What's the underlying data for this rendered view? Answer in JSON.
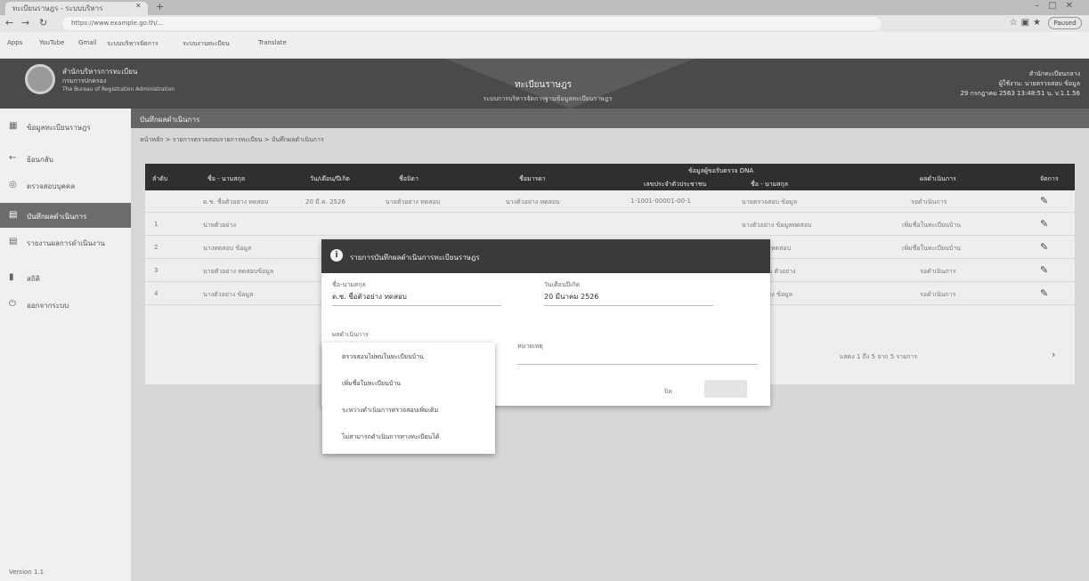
{
  "browser": {
    "tab_title": "ทะเบียนราษฎร - ระบบบริหาร",
    "address": "https://www.example.go.th/...",
    "bookmarks": [
      "Apps",
      "YouTube",
      "Gmail",
      "ระบบบริหารจัดการ",
      "ระบบงานทะเบียน",
      "Translate"
    ],
    "profile": "Paused"
  },
  "header": {
    "org_line1": "สำนักบริหารการทะเบียน",
    "org_line2": "กรมการปกครอง",
    "org_line3": "The Bureau of Registration Administration",
    "title": "ทะเบียนราษฎร",
    "subtitle": "ระบบการบริหารจัดการฐานข้อมูลทะเบียนราษฎร",
    "user_line1": "สำนักทะเบียนกลาง",
    "user_line2": "ผู้ใช้งาน: นายตรวจสอบ ข้อมูล",
    "user_line3": "29 กรกฎาคม 2563 13:48:51 น. v.1.1.56"
  },
  "sidebar": {
    "items": [
      {
        "label": "ข้อมูลทะเบียนราษฎร",
        "icon": "grid-icon"
      },
      {
        "label": "ย้อนกลับ",
        "icon": "back-icon"
      },
      {
        "label": "ตรวจสอบบุคคล",
        "icon": "user-search-icon"
      },
      {
        "label": "บันทึกผลดำเนินการ",
        "icon": "document-icon"
      },
      {
        "label": "รายงานผลการดำเนินงาน",
        "icon": "report-icon"
      },
      {
        "label": "สถิติ",
        "icon": "chart-icon"
      },
      {
        "label": "ออกจากระบบ",
        "icon": "logout-icon"
      }
    ],
    "footer": "Version 1.1"
  },
  "main": {
    "page_title": "บันทึกผลดำเนินการ",
    "breadcrumb": "หน้าหลัก > รายการตรวจสอบรายการทะเบียน > บันทึกผลดำเนินการ",
    "table": {
      "group_header": "ข้อมูลผู้ขอรับตรวจ DNA",
      "columns": [
        "ลำดับ",
        "ชื่อ - นามสกุล",
        "วัน/เดือน/ปีเกิด",
        "ชื่อบิดา",
        "ชื่อมารดา",
        "เลขประจำตัวประชาชน",
        "ชื่อ - นามสกุล",
        "ผลดำเนินการ",
        "จัดการ"
      ],
      "rows": [
        [
          "",
          "ด.ช. ชื่อตัวอย่าง ทดสอบ",
          "20 มี.ค. 2526",
          "นายตัวอย่าง ทดสอบ",
          "นางตัวอย่าง ทดสอบ",
          "1-1001-00001-00-1",
          "นายตรวจสอบ ข้อมูล",
          "รอดำเนินการ"
        ],
        [
          "1",
          "นายตัวอย่าง",
          "",
          "",
          "",
          "",
          "นางตัวอย่าง ข้อมูลทดสอบ",
          "เพิ่มชื่อในทะเบียนบ้าน"
        ],
        [
          "2",
          "นางทดสอบ ข้อมูล",
          "",
          "",
          "",
          "",
          "นายข้อมูล ทดสอบ",
          "เพิ่มชื่อในทะเบียนบ้าน"
        ],
        [
          "3",
          "นายตัวอย่าง ทดสอบข้อมูล",
          "",
          "",
          "",
          "",
          "นางทดสอบ ตัวอย่าง",
          "รอดำเนินการ"
        ],
        [
          "4",
          "นางตัวอย่าง ข้อมูล",
          "",
          "",
          "",
          "",
          "นายตัวอย่าง ข้อมูล",
          "รอดำเนินการ"
        ]
      ],
      "pager": "แสดง 1 ถึง 5 จาก 5 รายการ"
    }
  },
  "modal": {
    "title": "รายการบันทึกผลดำเนินการทะเบียนราษฎร",
    "name_label": "ชื่อ-นามสกุล",
    "name_value": "ด.ช. ชื่อตัวอย่าง ทดสอบ",
    "dob_label": "วันเดือนปีเกิด",
    "dob_value": "20 มีนาคม 2526",
    "result_label": "ผลดำเนินการ",
    "result_select": "",
    "note_label": "หมายเหตุ",
    "close_label": "ปิด",
    "ok_label": ""
  },
  "dropdown": {
    "options": [
      "ตรวจสอบไม่พบในทะเบียนบ้าน",
      "เพิ่มชื่อในทะเบียนบ้าน",
      "ระหว่างดำเนินการตรวจสอบเพิ่มเติม",
      "ไม่สามารถดำเนินการทางทะเบียนได้"
    ]
  }
}
